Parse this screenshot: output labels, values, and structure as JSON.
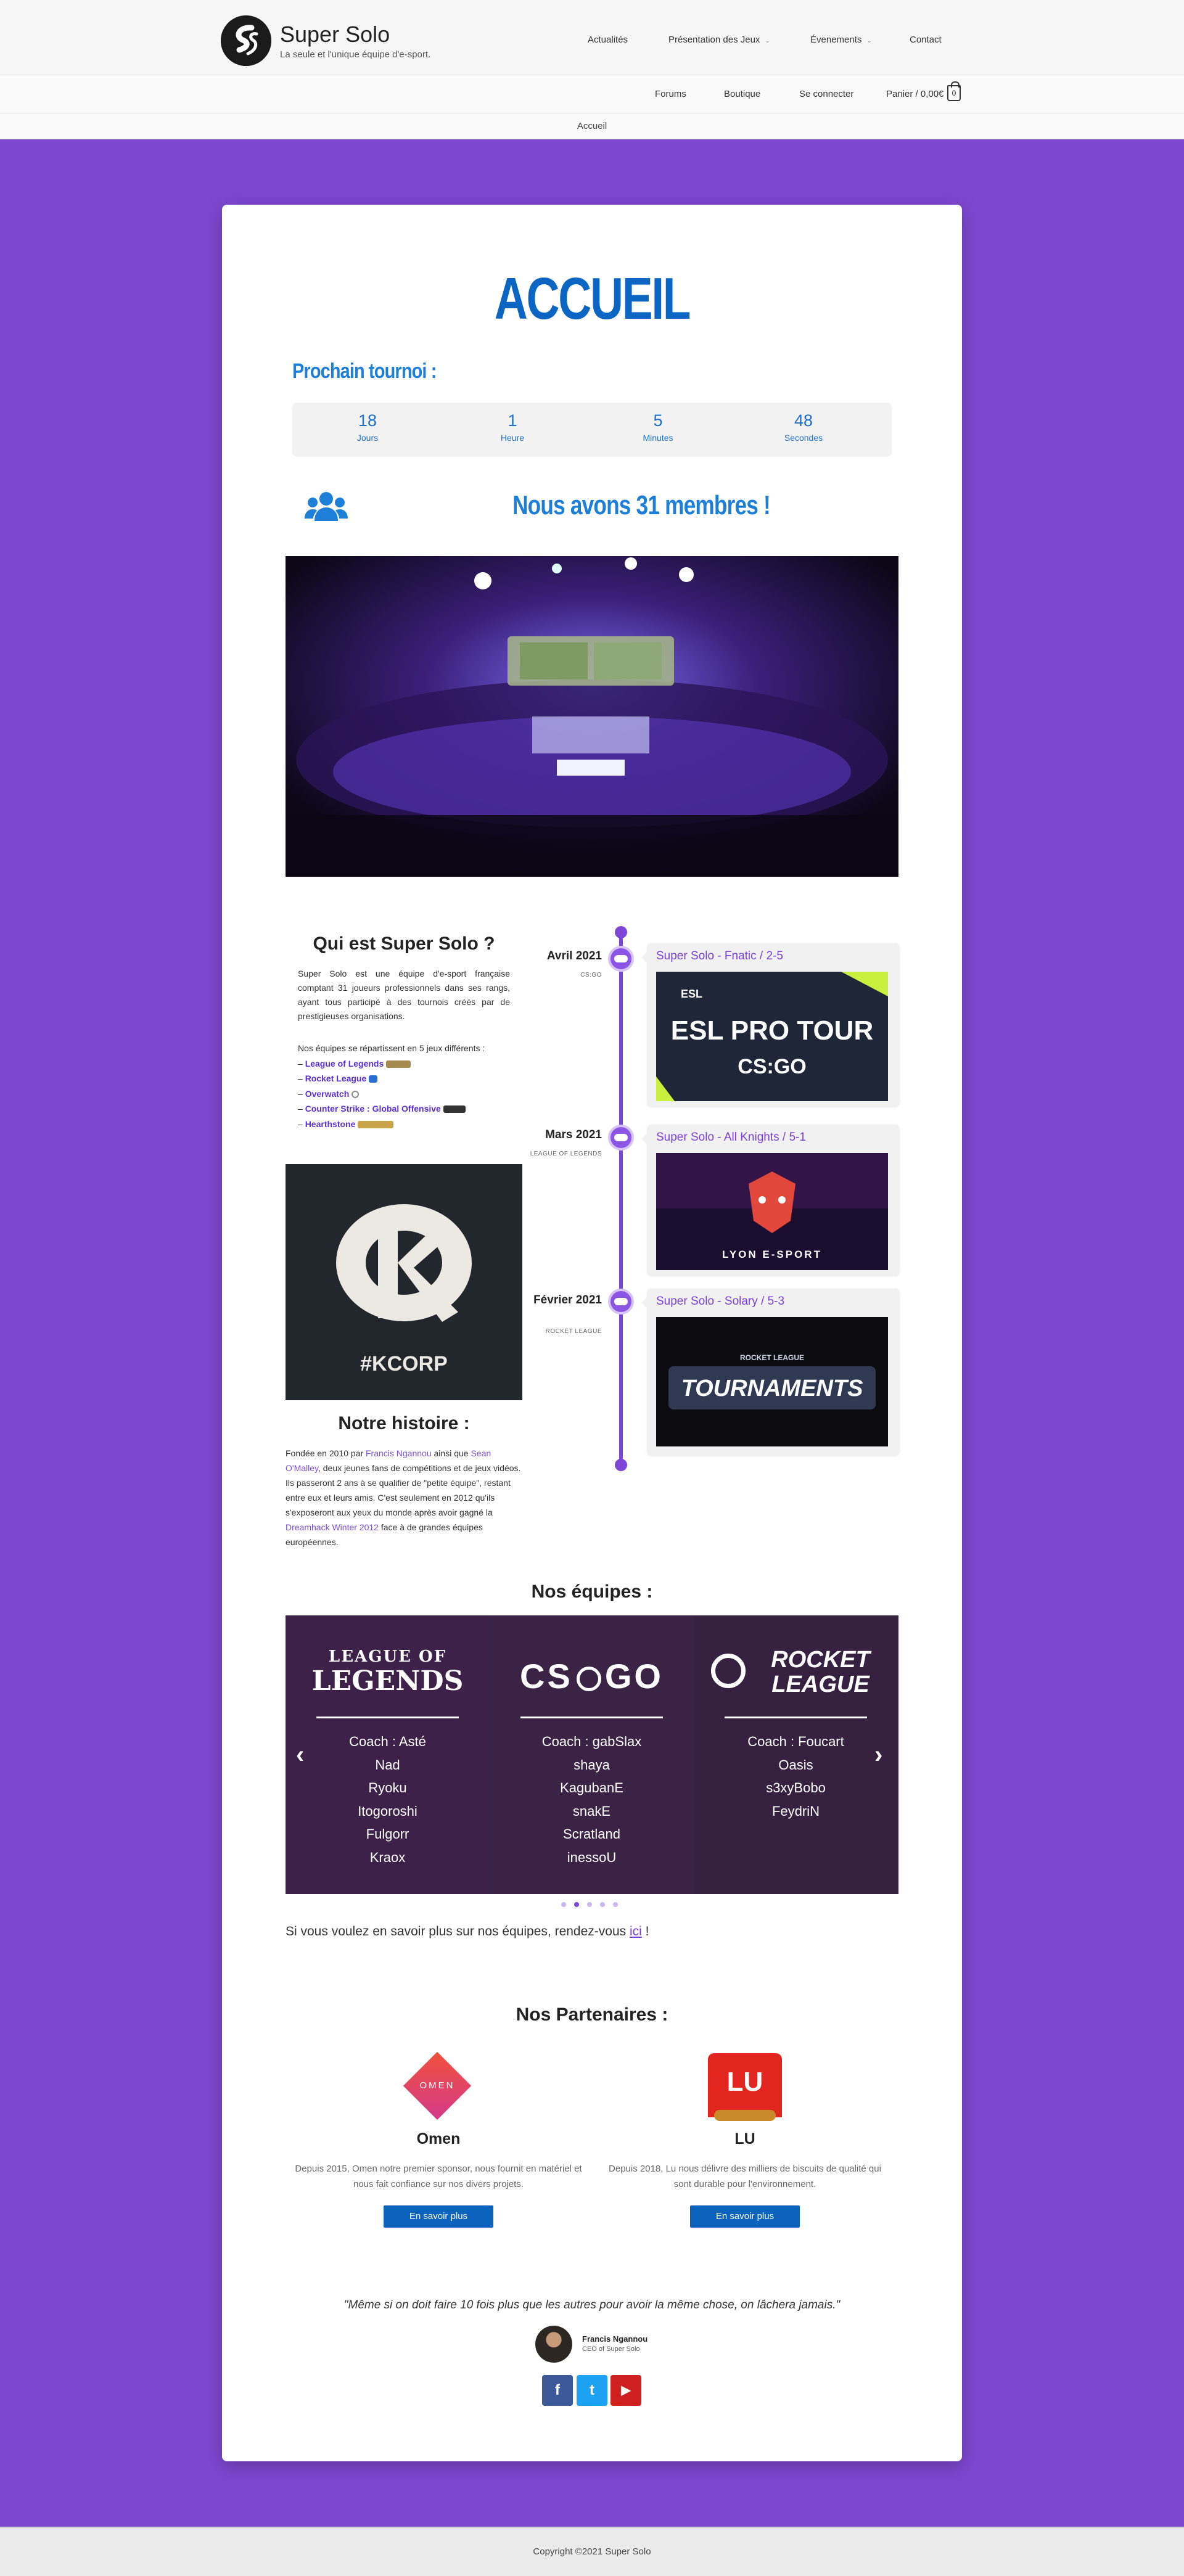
{
  "header": {
    "site_title": "Super Solo",
    "tagline": "La seule et l'unique équipe d'e-sport.",
    "nav_primary": [
      {
        "label": "Actualités"
      },
      {
        "label": "Présentation des Jeux"
      },
      {
        "label": "Évenements"
      },
      {
        "label": "Contact"
      }
    ],
    "nav_secondary": [
      {
        "label": "Forums"
      },
      {
        "label": "Boutique"
      },
      {
        "label": "Se connecter"
      },
      {
        "label": "Panier / 0,00€"
      }
    ],
    "cart_count": "0",
    "breadcrumb": "Accueil"
  },
  "main": {
    "page_title": "ACCUEIL",
    "next_tournament_label": "Prochain tournoi :",
    "countdown": [
      {
        "value": "18",
        "unit": "Jours"
      },
      {
        "value": "1",
        "unit": "Heure"
      },
      {
        "value": "5",
        "unit": "Minutes"
      },
      {
        "value": "48",
        "unit": "Secondes"
      }
    ],
    "members_text": "Nous avons 31 membres !",
    "about": {
      "title": "Qui est Super Solo ?",
      "text": "Super Solo est une équipe d'e-sport française comptant 31 joueurs professionnels dans ses rangs, ayant tous participé à des tournois créés par de prestigieuses organisations.",
      "games_intro": "Nos équipes se répartissent en 5 jeux différents :",
      "games": [
        {
          "name": "League of Legends",
          "color": "#a58a4f"
        },
        {
          "name": "Rocket League",
          "color": "#2a6ed1"
        },
        {
          "name": "Overwatch",
          "color": "#9a9a9a"
        },
        {
          "name": "Counter Strike : Global Offensive",
          "color": "#333333"
        },
        {
          "name": "Hearthstone",
          "color": "#c8a44a"
        }
      ]
    },
    "kcorp_label": "#KCORP",
    "history": {
      "title": "Notre histoire :",
      "p1": "Fondée en 2010 par ",
      "founder1": "Francis Ngannou",
      "p2": " ainsi que ",
      "founder2": "Sean O'Malley",
      "p3": ", deux jeunes fans de compétitions et de jeux vidéos. Ils passeront 2 ans à se qualifier de \"petite équipe\", restant entre eux et leurs amis. C'est seulement en 2012 qu'ils s'exposeront aux yeux du monde après avoir gagné la ",
      "event": "Dreamhack Winter 2012",
      "p4": " face à de grandes équipes européennes."
    },
    "timeline": [
      {
        "date": "Avril 2021",
        "game": "CS:GO",
        "title": "Super Solo - Fnatic / 2-5",
        "img_top": "ESL",
        "img_main": "ESL PRO TOUR",
        "img_sub": "CS:GO"
      },
      {
        "date": "Mars 2021",
        "game": "LEAGUE OF LEGENDS",
        "title": "Super Solo - All Knights / 5-1",
        "img_main": "LYON E-SPORT"
      },
      {
        "date": "Février 2021",
        "game": "ROCKET LEAGUE",
        "title": "Super Solo - Solary / 5-3",
        "img_top": "ROCKET LEAGUE",
        "img_main": "TOURNAMENTS"
      }
    ],
    "teams": {
      "title": "Nos équipes :",
      "slides": [
        {
          "logo_line1": "LEAGUE OF",
          "logo_line2": "LEGENDS",
          "members": [
            "Coach : Asté",
            "Nad",
            "Ryoku",
            "Itogoroshi",
            "Fulgorr",
            "Kraox"
          ]
        },
        {
          "logo_line1": "CS",
          "logo_line2": "GO",
          "members": [
            "Coach : gabSlax",
            "shaya",
            "KagubanE",
            "snakE",
            "Scratland",
            "inessoU"
          ]
        },
        {
          "logo_line1": "ROCKET",
          "logo_line2": "LEAGUE",
          "members": [
            "Coach : Foucart",
            "Oasis",
            "s3xyBobo",
            "FeydriN"
          ]
        }
      ],
      "prev_glyph": "‹",
      "next_glyph": "›",
      "more_text": "Si vous voulez en savoir plus sur nos équipes, rendez-vous ",
      "more_link": "ici",
      "more_end": " !"
    },
    "partners": {
      "title": "Nos Partenaires :",
      "items": [
        {
          "logo": "OMEN",
          "name": "Omen",
          "text": "Depuis 2015, Omen notre premier sponsor, nous fournit en matériel et nous fait confiance sur nos divers projets.",
          "button": "En savoir plus"
        },
        {
          "logo": "LU",
          "name": "LU",
          "text": "Depuis 2018, Lu nous délivre des milliers de biscuits de qualité qui sont durable pour l'environnement.",
          "button": "En savoir plus"
        }
      ]
    },
    "quote": {
      "text": "\"Même si on doit faire 10 fois plus que les autres pour avoir la même chose, on lâchera jamais.\"",
      "author": "Francis Ngannou",
      "role": "CEO of Super Solo"
    },
    "social": [
      {
        "icon": "facebook-icon",
        "glyph": "f",
        "color": "#3b5998"
      },
      {
        "icon": "twitter-icon",
        "glyph": "t",
        "color": "#1da1f2"
      },
      {
        "icon": "youtube-icon",
        "glyph": "▶",
        "color": "#cd201f"
      }
    ]
  },
  "footer": {
    "copyright": "Copyright ©2021 Super Solo"
  }
}
